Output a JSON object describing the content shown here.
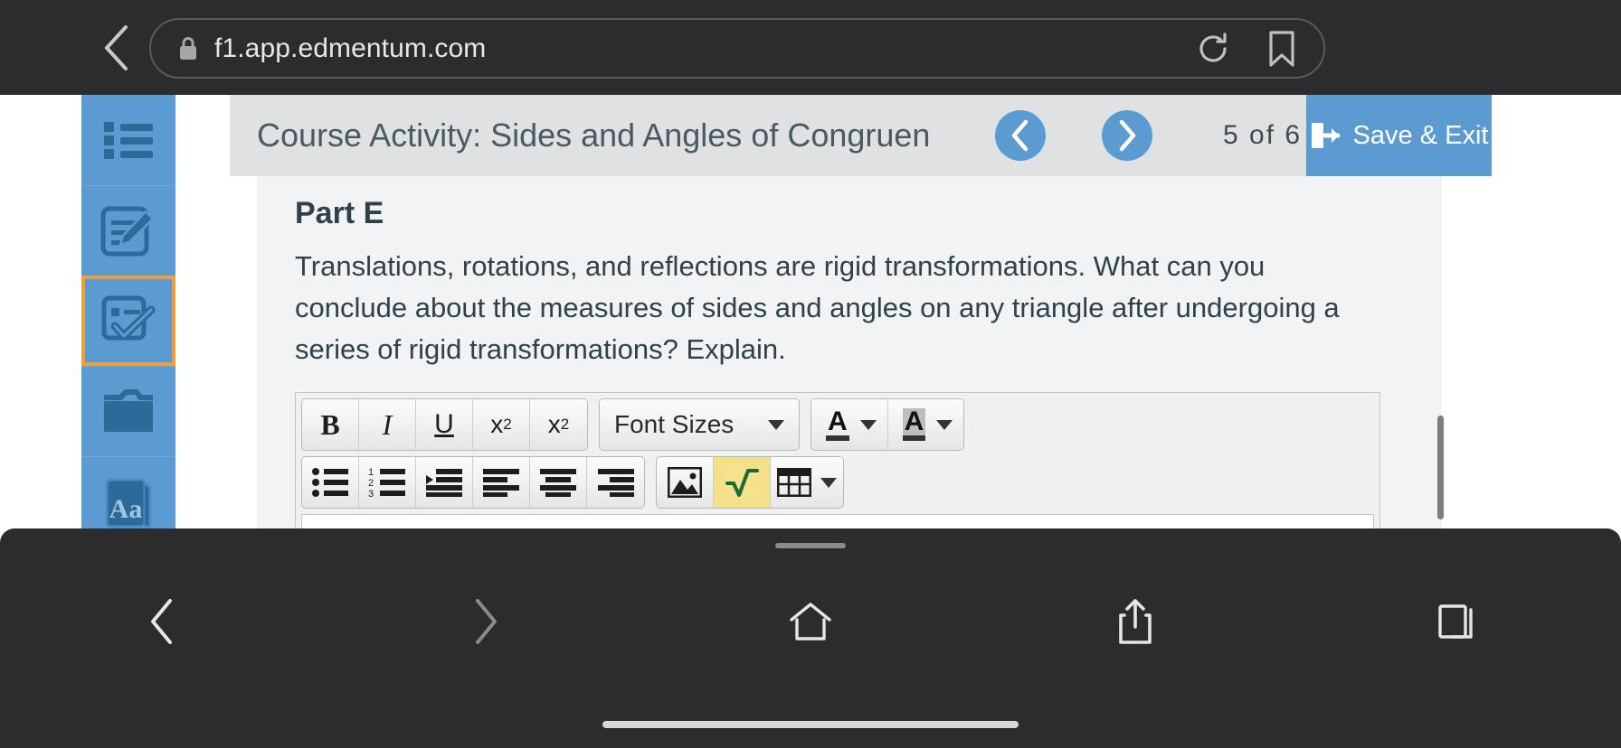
{
  "browser": {
    "url": "f1.app.edmentum.com",
    "back_label": "Back",
    "lock_icon": "lock-icon",
    "reload_icon": "reload-icon",
    "bookmark_icon": "bookmark-icon"
  },
  "sidebar": {
    "items": [
      {
        "name": "course-list",
        "icon": "list-icon"
      },
      {
        "name": "notes",
        "icon": "notepad-pencil-icon"
      },
      {
        "name": "assignments",
        "icon": "checklist-check-icon",
        "selected": true
      },
      {
        "name": "resources",
        "icon": "folder-icon"
      },
      {
        "name": "glossary",
        "icon": "dictionary-icon",
        "label": "Aa"
      },
      {
        "name": "read-aloud",
        "icon": "speaker-icon"
      }
    ]
  },
  "header": {
    "title": "Course Activity: Sides and Angles of Congruen",
    "prev_label": "Previous",
    "next_label": "Next",
    "page_current": "5",
    "page_of": "of",
    "page_total": "6",
    "save_exit_label": "Save & Exit",
    "accent_color": "#5b9bd1",
    "bar_color": "#dfe1e2"
  },
  "main": {
    "part_title": "Part E",
    "question": "Translations, rotations, and reflections are rigid transformations. What can you conclude about the measures of sides and angles on any triangle after undergoing a series of rigid transformations? Explain."
  },
  "editor": {
    "row1": {
      "bold": "B",
      "italic": "I",
      "underline": "U",
      "superscript_base": "x",
      "superscript_exp": "2",
      "subscript_base": "x",
      "subscript_exp": "2",
      "font_sizes_label": "Font Sizes",
      "text_color_label": "A",
      "background_color_label": "A"
    },
    "row2": {
      "bullet_list": "bullet-list-icon",
      "numbered_list": "numbered-list-icon",
      "indent": "indent-icon",
      "align_left": "align-left-icon",
      "align_center": "align-center-icon",
      "align_right": "align-right-icon",
      "insert_image": "image-icon",
      "insert_math": "math-sqrt-icon",
      "insert_table": "table-icon"
    },
    "content": ""
  },
  "systembar": {
    "back_icon": "chevron-left-icon",
    "forward_icon": "chevron-right-icon",
    "home_icon": "home-icon",
    "share_icon": "share-icon",
    "tabs_icon": "tabs-icon"
  }
}
